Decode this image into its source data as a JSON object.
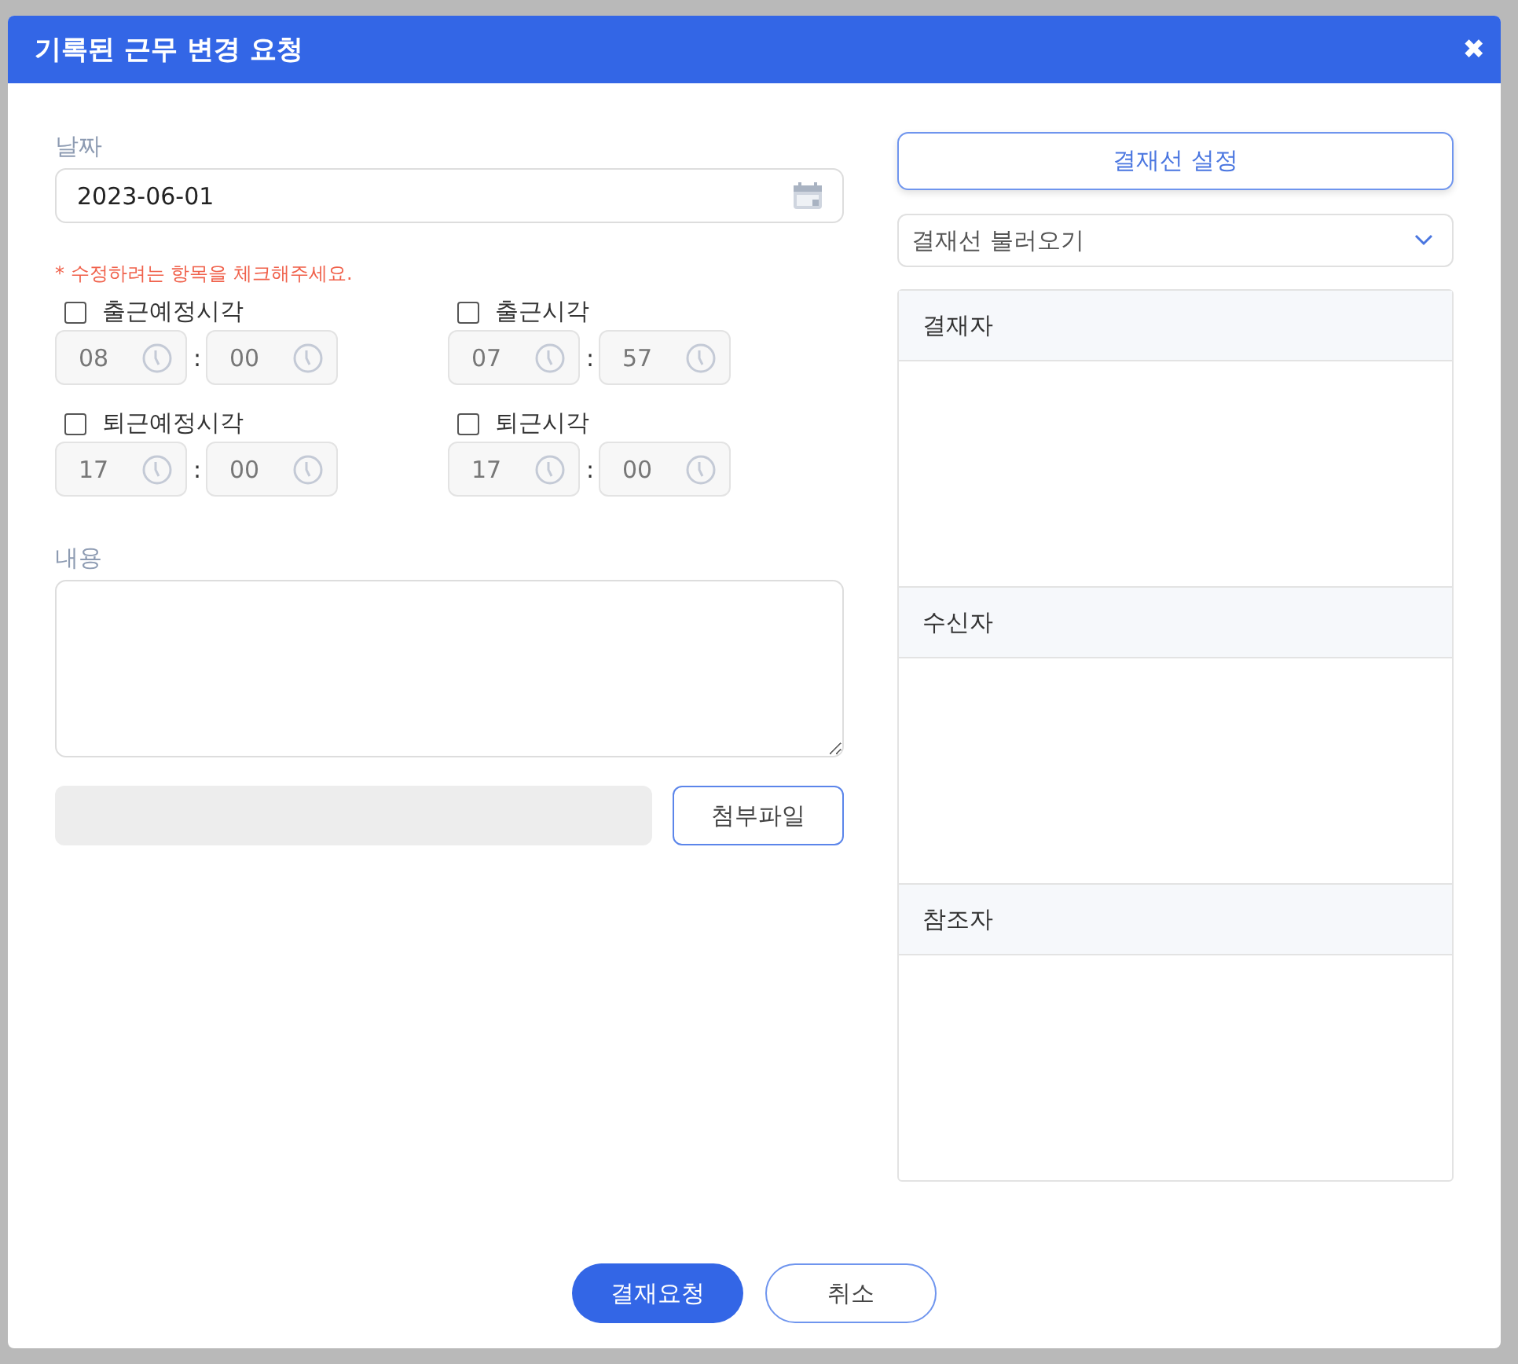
{
  "window": {
    "title": "기록된 근무 변경 요청",
    "close": "✖"
  },
  "date": {
    "label": "날짜",
    "value": "2023-06-01"
  },
  "notice": "* 수정하려는 항목을 체크해주세요.",
  "time_items": [
    {
      "label": "출근예정시각",
      "checked": false,
      "hour": "08",
      "minute": "00"
    },
    {
      "label": "출근시각",
      "checked": false,
      "hour": "07",
      "minute": "57"
    },
    {
      "label": "퇴근예정시각",
      "checked": false,
      "hour": "17",
      "minute": "00"
    },
    {
      "label": "퇴근시각",
      "checked": false,
      "hour": "17",
      "minute": "00"
    }
  ],
  "separator": ":",
  "content": {
    "label": "내용"
  },
  "attach_button": "첨부파일",
  "approval_setup_button": "결재선 설정",
  "approval_load_select": "결재선 불러오기",
  "sections": [
    {
      "title": "결재자"
    },
    {
      "title": "수신자"
    },
    {
      "title": "참조자"
    }
  ],
  "buttons": [
    {
      "label": "결재요청",
      "kind": "primary"
    },
    {
      "label": "취소",
      "kind": "secondary"
    }
  ]
}
